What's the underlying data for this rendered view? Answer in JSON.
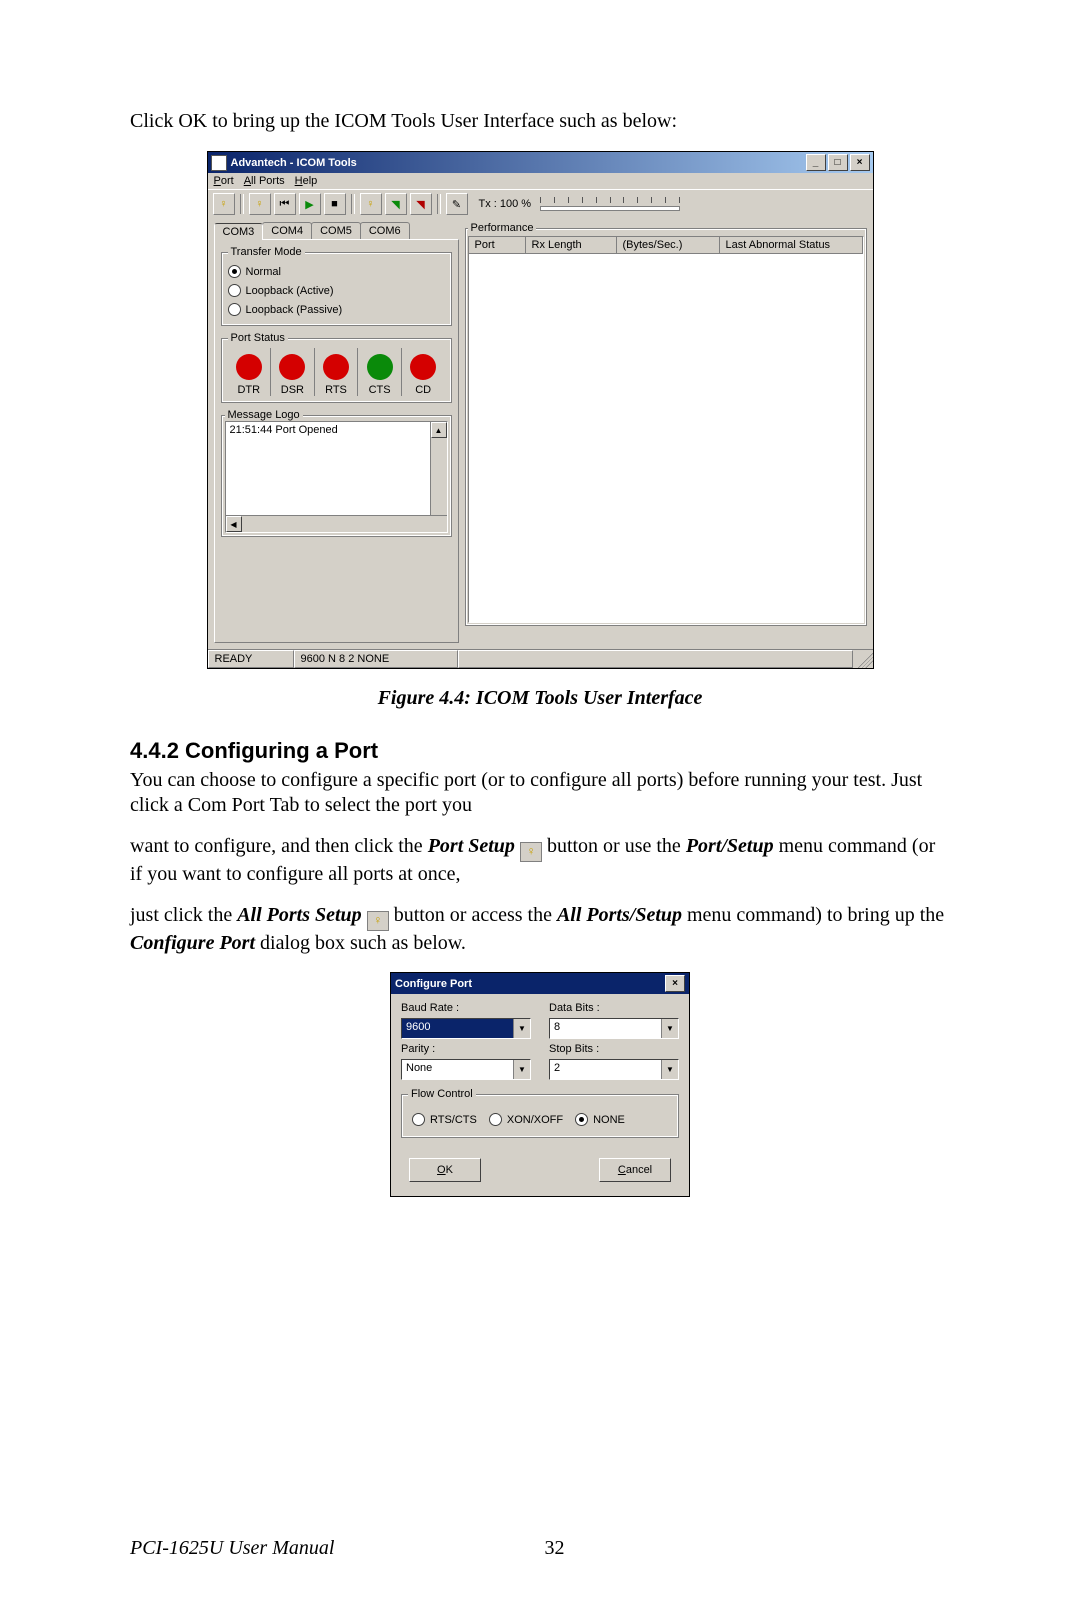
{
  "intro_text": "Click OK to bring up the ICOM Tools User Interface such as below:",
  "icom": {
    "title": "Advantech - ICOM Tools",
    "menus": {
      "port": "Port",
      "allports": "All Ports",
      "help": "Help"
    },
    "tx_label": "Tx : 100 %",
    "tabs": [
      "COM3",
      "COM4",
      "COM5",
      "COM6"
    ],
    "transfer_legend": "Transfer Mode",
    "radios": {
      "normal": "Normal",
      "loop_active": "Loopback (Active)",
      "loop_passive": "Loopback (Passive)"
    },
    "portstatus_legend": "Port Status",
    "ps_labels": [
      "DTR",
      "DSR",
      "RTS",
      "CTS",
      "CD"
    ],
    "ps_colors": [
      "red",
      "red",
      "red",
      "green",
      "red"
    ],
    "msglog_legend": "Message Logo",
    "msglog_line": "21:51:44  Port Opened",
    "perf_legend": "Performance",
    "perf_cols": [
      "Port",
      "Rx Length",
      "(Bytes/Sec.)",
      "Last Abnormal Status"
    ],
    "status_ready": "READY",
    "status_cfg": "9600 N 8 2 NONE"
  },
  "fig_caption": "Figure 4.4: ICOM Tools User Interface",
  "sec_heading": "4.4.2 Configuring a Port",
  "p1": "You can choose to configure a specific port (or to configure all ports) before running your test. Just click a Com Port Tab to select the port you",
  "p2a": "want to configure, and then click the ",
  "p2b_em": "Port Setup",
  "p2c": " button or use the ",
  "p2d_em": "Port/Setup",
  "p2e": " menu command (or if you want to configure all ports at once,",
  "p3a": "just click the ",
  "p3b_em": "All Ports Setup",
  "p3c": " button or access the ",
  "p3d_em": "All Ports/Setup",
  "p3e": " menu command) to bring up the ",
  "p3f_em": "Configure Port",
  "p3g": " dialog box such as below.",
  "dlg": {
    "title": "Configure Port",
    "baud_label": "Baud Rate :",
    "baud_value": "9600",
    "data_label": "Data Bits :",
    "data_value": "8",
    "parity_label": "Parity :",
    "parity_value": "None",
    "stop_label": "Stop Bits :",
    "stop_value": "2",
    "flow_legend": "Flow Control",
    "flow_opts": {
      "rtscts": "RTS/CTS",
      "xon": "XON/XOFF",
      "none": "NONE"
    },
    "ok": "OK",
    "cancel": "Cancel"
  },
  "footer_manual": "PCI-1625U User Manual",
  "footer_page": "32"
}
